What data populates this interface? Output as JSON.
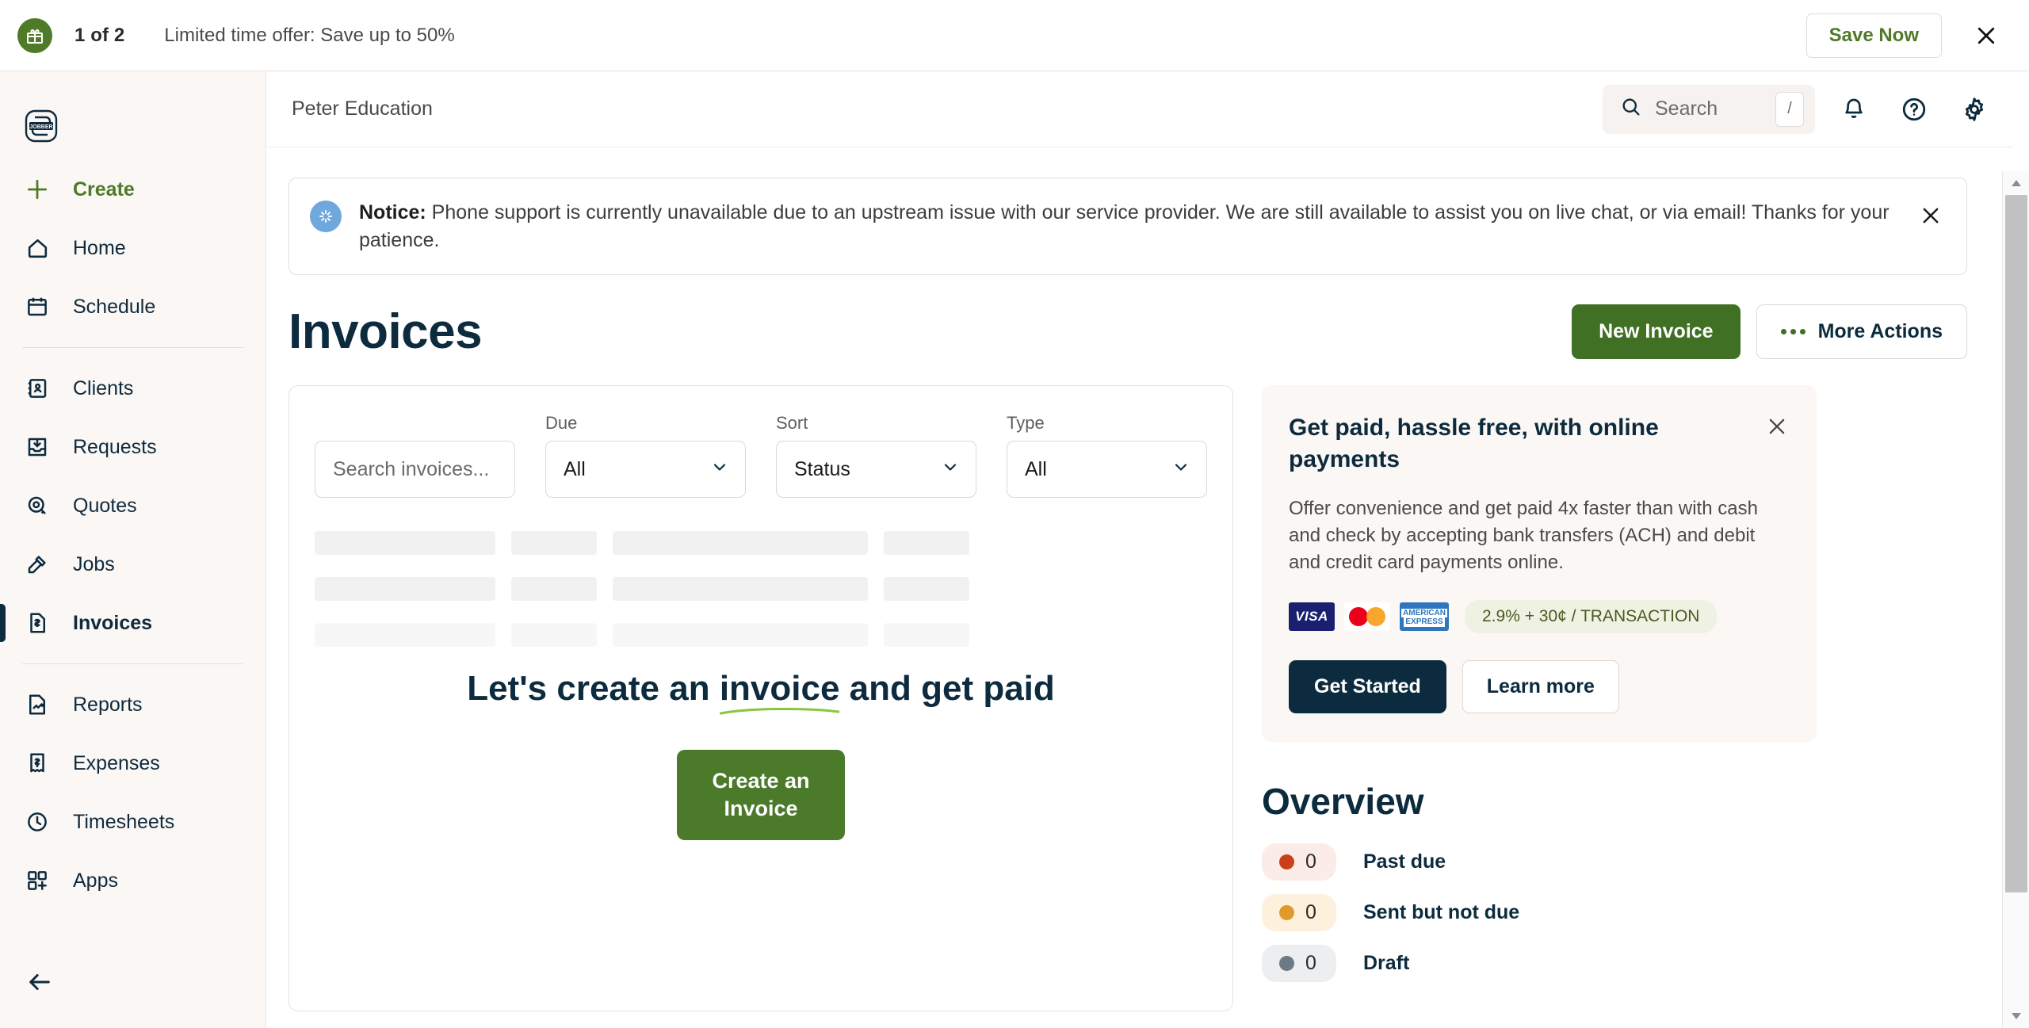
{
  "promo_bar": {
    "gift_icon": "gift-icon",
    "counter": "1 of 2",
    "message": "Limited time offer: Save up to 50%",
    "save_label": "Save Now",
    "close_icon": "close-icon"
  },
  "sidebar": {
    "logo": "jobber-logo",
    "groups": [
      {
        "items": [
          {
            "label": "Create",
            "icon": "plus-icon",
            "name": "create"
          },
          {
            "label": "Home",
            "icon": "home-icon",
            "name": "home"
          },
          {
            "label": "Schedule",
            "icon": "calendar-icon",
            "name": "schedule"
          }
        ]
      },
      {
        "items": [
          {
            "label": "Clients",
            "icon": "contact-book-icon",
            "name": "clients"
          },
          {
            "label": "Requests",
            "icon": "inbox-down-icon",
            "name": "requests"
          },
          {
            "label": "Quotes",
            "icon": "tape-measure-icon",
            "name": "quotes"
          },
          {
            "label": "Jobs",
            "icon": "hammer-icon",
            "name": "jobs"
          },
          {
            "label": "Invoices",
            "icon": "invoice-dollar-icon",
            "name": "invoices"
          }
        ]
      },
      {
        "items": [
          {
            "label": "Reports",
            "icon": "report-chart-icon",
            "name": "reports"
          },
          {
            "label": "Expenses",
            "icon": "receipt-dollar-icon",
            "name": "expenses"
          },
          {
            "label": "Timesheets",
            "icon": "clock-icon",
            "name": "timesheets"
          },
          {
            "label": "Apps",
            "icon": "apps-grid-plus-icon",
            "name": "apps"
          }
        ]
      }
    ],
    "active": "Invoices",
    "collapse_icon": "arrow-left-icon"
  },
  "topbar": {
    "account": "Peter Education",
    "search_placeholder": "Search",
    "search_icon": "search-icon",
    "search_shortcut": "/",
    "notifications_icon": "bell-icon",
    "help_icon": "question-circle-icon",
    "settings_icon": "gear-icon"
  },
  "notice": {
    "icon": "sparkle-icon",
    "label": "Notice:",
    "body": " Phone support is currently unavailable due to an upstream issue with our service provider. We are still available to assist you on live chat, or via email! Thanks for your patience.",
    "close_icon": "close-icon"
  },
  "page": {
    "title": "Invoices",
    "new_invoice_label": "New Invoice",
    "more_actions_label": "More Actions",
    "more_actions_icon": "ellipsis-icon"
  },
  "filters": {
    "search_placeholder": "Search invoices...",
    "due": {
      "label": "Due",
      "value": "All"
    },
    "sort": {
      "label": "Sort",
      "value": "Status"
    },
    "type": {
      "label": "Type",
      "value": "All"
    },
    "chevron_icon": "chevron-down-icon"
  },
  "empty_state": {
    "title_before": "Let's create an ",
    "title_highlight": "invoice",
    "title_after": " and get paid",
    "cta_line1": "Create an",
    "cta_line2": "Invoice"
  },
  "payments_card": {
    "title": "Get paid, hassle free, with online payments",
    "body": "Offer convenience and get paid 4x faster than with cash and check by accepting bank transfers (ACH) and debit and credit card payments online.",
    "close_icon": "close-icon",
    "card_logos": [
      "VISA",
      "mastercard",
      "AMERICAN EXPRESS"
    ],
    "fee": "2.9% + 30¢ / TRANSACTION",
    "primary_label": "Get Started",
    "secondary_label": "Learn more"
  },
  "overview": {
    "title": "Overview",
    "rows": [
      {
        "count": "0",
        "label": "Past due",
        "dot_color": "#c9401a",
        "pill_bg": "#fbece8"
      },
      {
        "count": "0",
        "label": "Sent but not due",
        "dot_color": "#e09a2c",
        "pill_bg": "#fdf1de"
      },
      {
        "count": "0",
        "label": "Draft",
        "dot_color": "#6b7a85",
        "pill_bg": "#eceef0"
      }
    ]
  },
  "colors": {
    "brand_green": "#3f7023",
    "navy": "#0d2b3e",
    "sidebar_bg": "#faf7f4"
  },
  "scrollbar": {
    "up_icon": "caret-up-icon",
    "down_icon": "caret-down-icon"
  }
}
